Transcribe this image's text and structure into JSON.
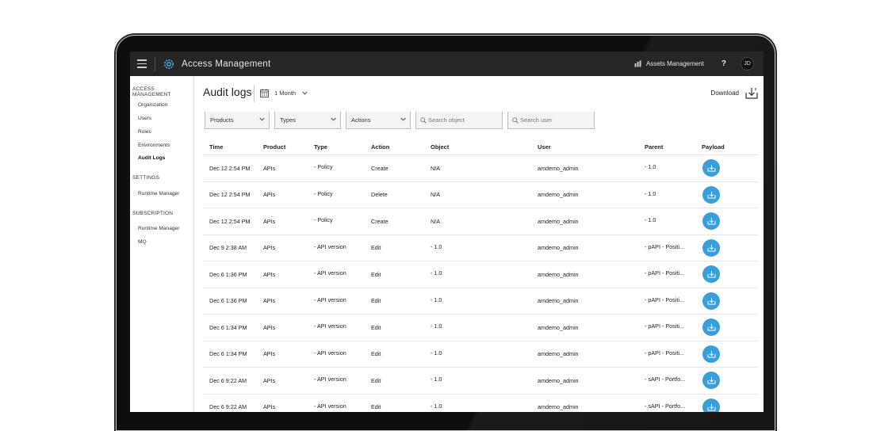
{
  "topbar": {
    "title": "Access Management",
    "assets_label": "Assets Management",
    "help_label": "?",
    "avatar_initials": "JD"
  },
  "sidebar": {
    "sections": [
      {
        "heading": "ACCESS MANAGEMENT",
        "items": [
          "Organization",
          "Users",
          "Roles",
          "Environments",
          "Audit Logs"
        ]
      },
      {
        "heading": "SETTINGS",
        "items": [
          "Runtime Manager"
        ]
      },
      {
        "heading": "SUBSCRIPTION",
        "items": [
          "Runtime Manager",
          "MQ"
        ]
      }
    ],
    "active_item": "Audit Logs"
  },
  "main": {
    "title": "Audit logs",
    "date_range": "1 Month",
    "download_label": "Download",
    "filters": {
      "products": "Products",
      "types": "Types",
      "actions": "Actions",
      "search_object_placeholder": "Search object",
      "search_user_placeholder": "Search user"
    }
  },
  "table": {
    "headers": {
      "time": "Time",
      "product": "Product",
      "type": "Type",
      "action": "Action",
      "object": "Object",
      "user": "User",
      "parent": "Parent",
      "payload": "Payload"
    },
    "rows": [
      {
        "time": "Dec 12 2:54 PM",
        "product": "APIs",
        "type": "- Policy",
        "action": "Create",
        "object": "N/A",
        "user": "amdemo_admin",
        "parent": "- 1.0"
      },
      {
        "time": "Dec 12 2:54 PM",
        "product": "APIs",
        "type": "- Policy",
        "action": "Delete",
        "object": "N/A",
        "user": "amdemo_admin",
        "parent": "- 1.0"
      },
      {
        "time": "Dec 12 2:54 PM",
        "product": "APIs",
        "type": "- Policy",
        "action": "Create",
        "object": "N/A",
        "user": "amdemo_admin",
        "parent": "- 1.0"
      },
      {
        "time": "Dec 9 2:38 AM",
        "product": "APIs",
        "type": "- API version",
        "action": "Edit",
        "object": "- 1.0",
        "user": "amdemo_admin",
        "parent": "- pAPI - Positi..."
      },
      {
        "time": "Dec 6 1:36 PM",
        "product": "APIs",
        "type": "- API version",
        "action": "Edit",
        "object": "- 1.0",
        "user": "amdemo_admin",
        "parent": "- pAPI - Positi..."
      },
      {
        "time": "Dec 6 1:36 PM",
        "product": "APIs",
        "type": "- API version",
        "action": "Edit",
        "object": "- 1.0",
        "user": "amdemo_admin",
        "parent": "- pAPI - Positi..."
      },
      {
        "time": "Dec 6 1:34 PM",
        "product": "APIs",
        "type": "- API version",
        "action": "Edit",
        "object": "- 1.0",
        "user": "amdemo_admin",
        "parent": "- pAPI - Positi..."
      },
      {
        "time": "Dec 6 1:34 PM",
        "product": "APIs",
        "type": "- API version",
        "action": "Edit",
        "object": "- 1.0",
        "user": "amdemo_admin",
        "parent": "- pAPI - Positi..."
      },
      {
        "time": "Dec 6 9:22 AM",
        "product": "APIs",
        "type": "- API version",
        "action": "Edit",
        "object": "- 1.0",
        "user": "amdemo_admin",
        "parent": "- sAPI - Portfo..."
      },
      {
        "time": "Dec 6 9:22 AM",
        "product": "APIs",
        "type": "- API version",
        "action": "Edit",
        "object": "- 1.0",
        "user": "amdemo_admin",
        "parent": "- sAPI - Portfo..."
      }
    ]
  },
  "colors": {
    "topbar": "#262626",
    "accent": "#3a9ed9",
    "gear": "#5fb3e6"
  },
  "icons": [
    "menu-icon",
    "gear-icon",
    "assets-icon",
    "calendar-icon",
    "chevron-down-icon",
    "download-icon",
    "search-icon",
    "payload-download-icon"
  ]
}
